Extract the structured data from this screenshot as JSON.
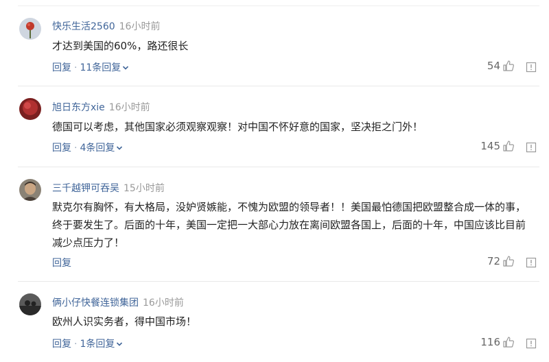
{
  "comments": [
    {
      "username": "快乐生活2560",
      "time": "16小时前",
      "text": "才达到美国的60%，路还很长",
      "reply_label": "回复",
      "replies_label": "11条回复",
      "likes": "54",
      "avatar_icon": "red-flower-avatar",
      "avatar_color": "#c0392b"
    },
    {
      "username": "旭日东方xie",
      "time": "16小时前",
      "text": "德国可以考虑，其他国家必须观察观察！对中国不怀好意的国家，坚决拒之门外！",
      "reply_label": "回复",
      "replies_label": "4条回复",
      "likes": "145",
      "avatar_icon": "red-blurred-avatar",
      "avatar_color": "#a52a2a"
    },
    {
      "username": "三千越钾可吞吴",
      "time": "15小时前",
      "text": "默克尔有胸怀，有大格局，没妒贤嫉能，不愧为欧盟的领导者！！美国最怕德国把欧盟整合成一体的事，终于要发生了。后面的十年，美国一定把一大部心力放在离间欧盟各国上，后面的十年，中国应该比目前减少点压力了！",
      "reply_label": "回复",
      "replies_label": "",
      "likes": "72",
      "avatar_icon": "person-portrait-avatar",
      "avatar_color": "#6b5d4f"
    },
    {
      "username": "俩小仔快餐连锁集团",
      "time": "16小时前",
      "text": "欧州人识实务者，得中国市场！",
      "reply_label": "回复",
      "replies_label": "1条回复",
      "likes": "116",
      "avatar_icon": "dark-silhouette-avatar",
      "avatar_color": "#3a3a3a"
    }
  ],
  "colors": {
    "username": "#406599",
    "time": "#999999",
    "body_text": "#222222",
    "action_link": "#406599",
    "count": "#666666"
  },
  "icons": {
    "like": "thumbs-up-icon",
    "report": "report-icon",
    "expand": "chevron-down-icon"
  }
}
